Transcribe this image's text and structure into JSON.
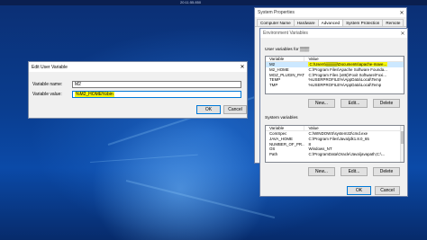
{
  "desktop": {
    "top_bar_text": "20:11:55.850"
  },
  "edit_dialog": {
    "title": "Edit User Variable",
    "close_glyph": "✕",
    "name_label": "Variable name:",
    "name_value": "M2",
    "value_label": "Variable value:",
    "value_value": "%M2_HOME%\\bin",
    "ok_label": "OK",
    "cancel_label": "Cancel"
  },
  "system_properties": {
    "title": "System Properties",
    "close_glyph": "✕",
    "tabs": [
      {
        "label": "Computer Name"
      },
      {
        "label": "Hardware"
      },
      {
        "label": "Advanced"
      },
      {
        "label": "System Protection"
      },
      {
        "label": "Remote"
      }
    ],
    "active_tab": "Advanced"
  },
  "env_dialog": {
    "title": "Environment Variables",
    "close_glyph": "✕",
    "user_section_label": "User variables for ",
    "user_section_name": "▒▒▒",
    "columns": {
      "variable": "Variable",
      "value": "Value"
    },
    "user_rows": [
      {
        "variable": "M2",
        "value": "C:\\Users\\▒▒▒▒\\Documents\\apache-mave..."
      },
      {
        "variable": "M2_HOME",
        "value": "C:\\Program Files\\Apache Software Founda..."
      },
      {
        "variable": "MOZ_PLUGIN_PATH",
        "value": "C:\\Program Files (x86)\\Foxit Software\\Foxi..."
      },
      {
        "variable": "TEMP",
        "value": "%USERPROFILE%\\AppData\\Local\\Temp"
      },
      {
        "variable": "TMP",
        "value": "%USERPROFILE%\\AppData\\Local\\Temp"
      }
    ],
    "system_section_label": "System variables",
    "system_rows": [
      {
        "variable": "ComSpec",
        "value": "C:\\WINDOWS\\system32\\cmd.exe"
      },
      {
        "variable": "JAVA_HOME",
        "value": "C:\\Program Files\\Java\\jdk1.8.0_65"
      },
      {
        "variable": "NUMBER_OF_PR...",
        "value": "8"
      },
      {
        "variable": "OS",
        "value": "Windows_NT"
      },
      {
        "variable": "Path",
        "value": "C:\\ProgramData\\Oracle\\Java\\javapath;C:\\..."
      }
    ],
    "buttons": {
      "new": "New...",
      "edit": "Edit...",
      "delete": "Delete",
      "ok": "OK",
      "cancel": "Cancel"
    }
  },
  "colors": {
    "highlight": "#f5f50a",
    "selection": "#cce8ff",
    "desktop": "#0a3d8f"
  }
}
